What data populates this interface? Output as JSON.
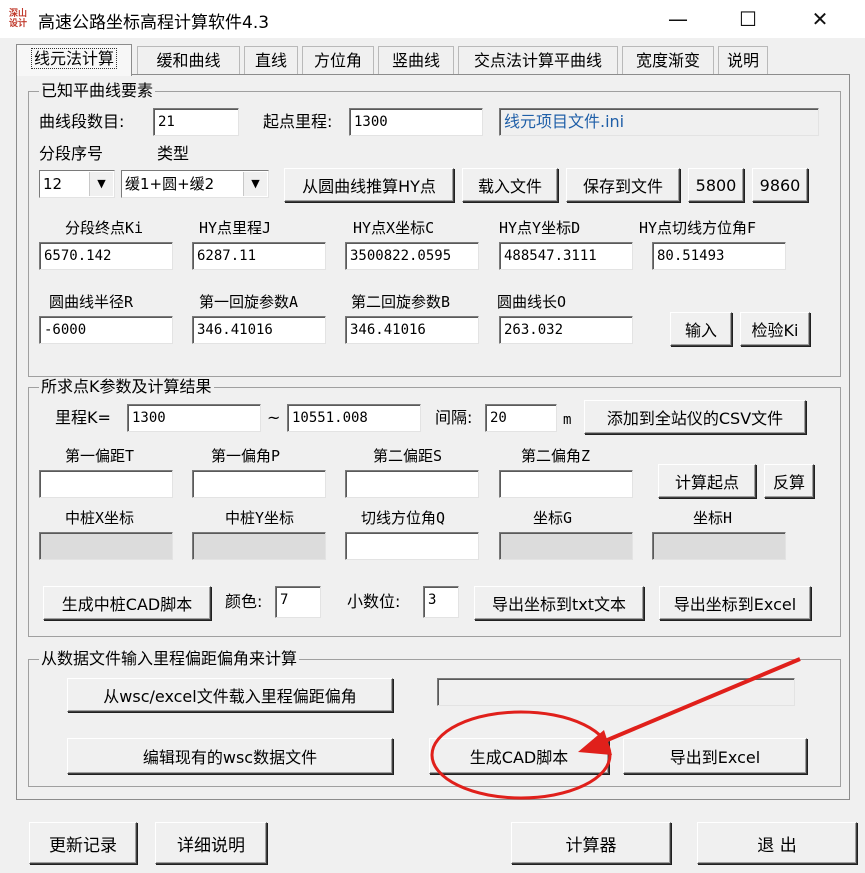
{
  "window": {
    "title": "高速公路坐标高程计算软件4.3",
    "app_icon_text": "深山\n设计"
  },
  "controls": {
    "minimize": "—",
    "maximize": "☐",
    "close": "✕"
  },
  "tabs": [
    "线元法计算",
    "缓和曲线",
    "直线",
    "方位角",
    "竖曲线",
    "交点法计算平曲线",
    "宽度渐变",
    "说明"
  ],
  "known": {
    "title": "已知平曲线要素",
    "segment_count_label": "曲线段数目:",
    "segment_count": "21",
    "start_station_label": "起点里程:",
    "start_station": "1300",
    "project_file": "线元项目文件.ini",
    "seq_label": "分段序号",
    "type_label": "类型",
    "seq_value": "12",
    "type_value": "缓1+圆+缓2",
    "btn_calc_hy": "从圆曲线推算HY点",
    "btn_load": "载入文件",
    "btn_save": "保存到文件",
    "btn_5800": "5800",
    "btn_9860": "9860",
    "ki_label": "分段终点Ki",
    "j_label": "HY点里程J",
    "c_label": "HY点X坐标C",
    "d_label": "HY点Y坐标D",
    "f_label": "HY点切线方位角F",
    "ki": "6570.142",
    "j": "6287.11",
    "c": "3500822.0595",
    "d": "488547.3111",
    "f": "80.51493",
    "r_label": "圆曲线半径R",
    "a_label": "第一回旋参数A",
    "b_label": "第二回旋参数B",
    "o_label": "圆曲线长O",
    "r": "-6000",
    "a": "346.41016",
    "b": "346.41016",
    "o": "263.032",
    "btn_input": "输入",
    "btn_check": "检验Ki"
  },
  "query": {
    "title": "所求点K参数及计算结果",
    "station_label": "里程K=",
    "station_from": "1300",
    "tilde": "~",
    "station_to": "10551.008",
    "interval_label": "间隔:",
    "interval": "20",
    "interval_unit": "m",
    "btn_add_csv": "添加到全站仪的CSV文件",
    "t_label": "第一偏距T",
    "p_label": "第一偏角P",
    "s_label": "第二偏距S",
    "z_label": "第二偏角Z",
    "btn_calc_start": "计算起点",
    "btn_reverse": "反算",
    "x_label": "中桩X坐标",
    "y_label": "中桩Y坐标",
    "q_label": "切线方位角Q",
    "g_label": "坐标G",
    "h_label": "坐标H",
    "btn_gen_cad": "生成中桩CAD脚本",
    "color_label": "颜色:",
    "color": "7",
    "decimals_label": "小数位:",
    "decimals": "3",
    "btn_export_txt": "导出坐标到txt文本",
    "btn_export_excel": "导出坐标到Excel"
  },
  "file_calc": {
    "title": "从数据文件输入里程偏距偏角来计算",
    "btn_load_wsc": "从wsc/excel文件载入里程偏距偏角",
    "btn_edit_wsc": "编辑现有的wsc数据文件",
    "btn_gen_cad": "生成CAD脚本",
    "btn_export_excel": "导出到Excel"
  },
  "bottom": {
    "btn_update_log": "更新记录",
    "btn_details": "详细说明",
    "btn_calculator": "计算器",
    "btn_exit": "退  出"
  },
  "colors": {
    "annotation": "#e0201b",
    "link_text": "#1f5fa8"
  }
}
